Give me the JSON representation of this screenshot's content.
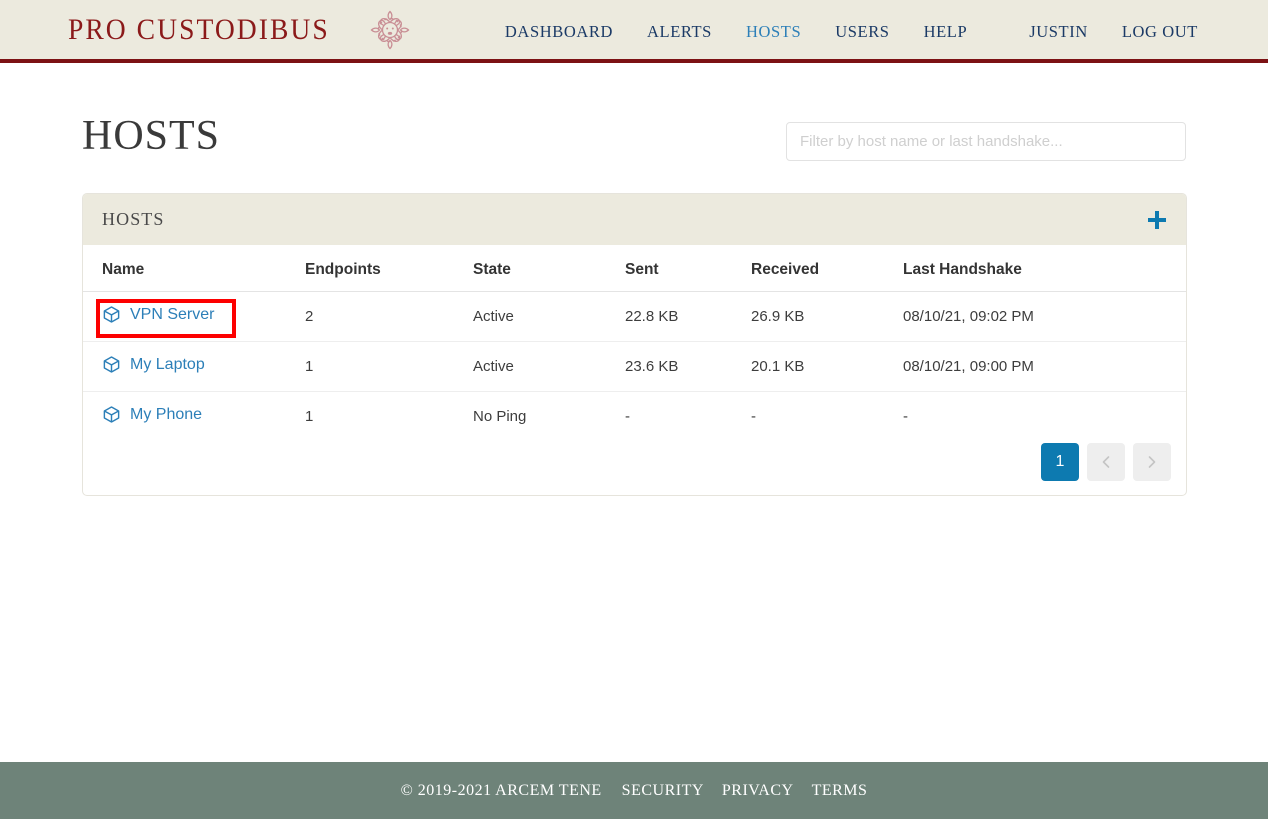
{
  "header": {
    "brand_text": "PRO CUSTODIBUS",
    "ornament_icon": "medusa-ornament-icon",
    "nav": [
      {
        "label": "DASHBOARD",
        "active": false
      },
      {
        "label": "ALERTS",
        "active": false
      },
      {
        "label": "HOSTS",
        "active": true
      },
      {
        "label": "USERS",
        "active": false
      },
      {
        "label": "HELP",
        "active": false
      }
    ],
    "user": "JUSTIN",
    "logout": "LOG OUT"
  },
  "page": {
    "title": "HOSTS"
  },
  "filter": {
    "value": "",
    "placeholder": "Filter by host name or last handshake..."
  },
  "card": {
    "title": "HOSTS",
    "add_icon": "plus-icon"
  },
  "table": {
    "columns": [
      "Name",
      "Endpoints",
      "State",
      "Sent",
      "Received",
      "Last Handshake"
    ],
    "rows": [
      {
        "name": "VPN Server",
        "icon": "cube-icon",
        "endpoints": "2",
        "state": "Active",
        "state_kind": "active",
        "sent": "22.8 KB",
        "received": "26.9 KB",
        "last_handshake": "08/10/21, 09:02 PM",
        "highlighted": true
      },
      {
        "name": "My Laptop",
        "icon": "cube-icon",
        "endpoints": "1",
        "state": "Active",
        "state_kind": "active",
        "sent": "23.6 KB",
        "received": "20.1 KB",
        "last_handshake": "08/10/21, 09:00 PM",
        "highlighted": false
      },
      {
        "name": "My Phone",
        "icon": "cube-icon",
        "endpoints": "1",
        "state": "No Ping",
        "state_kind": "noping",
        "sent": "-",
        "received": "-",
        "last_handshake": "-",
        "highlighted": false
      }
    ]
  },
  "pagination": {
    "current_page": "1",
    "prev_icon": "chevron-left-icon",
    "next_icon": "chevron-right-icon"
  },
  "footer": {
    "copyright": "© 2019-2021 ARCEM TENE",
    "links": [
      "SECURITY",
      "PRIVACY",
      "TERMS"
    ]
  },
  "colors": {
    "brand_red": "#8b1a1a",
    "header_rule": "#7c1214",
    "header_bg": "#eceade",
    "link_blue": "#2c7fb8",
    "nav_blue": "#1b3a66",
    "accent_blue": "#0d7ab0",
    "state_active": "#2d7a33",
    "state_noping": "#e02b20",
    "annotation_red": "#fd0000",
    "footer_bg": "#6e8379"
  }
}
